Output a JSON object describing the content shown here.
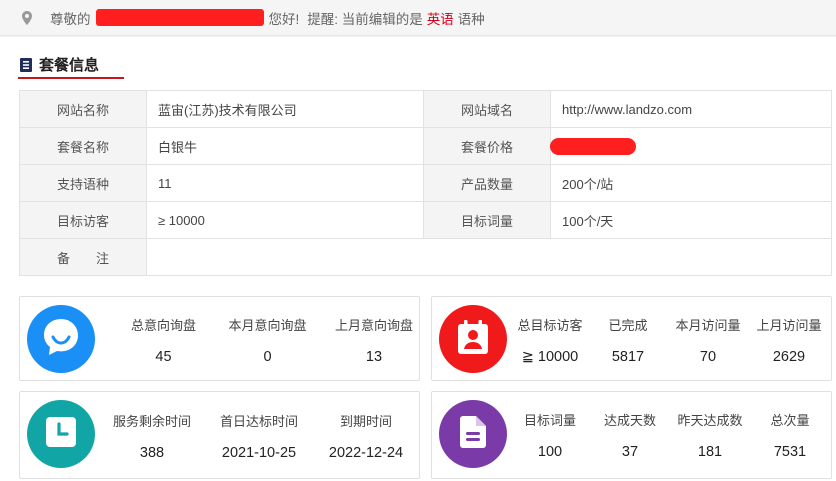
{
  "greeting": {
    "prefix": "尊敬的",
    "suffix": "您好!",
    "reminder_prefix": "提醒: 当前编辑的是",
    "language": "英语",
    "reminder_suffix": "语种"
  },
  "section": {
    "title": "套餐信息"
  },
  "info_rows": [
    {
      "l1": "网站名称",
      "v1": "蓝宙(江苏)技术有限公司",
      "l2": "网站域名",
      "v2": "http://www.landzo.com"
    },
    {
      "l1": "套餐名称",
      "v1": "白银牛",
      "l2": "套餐价格",
      "v2": ""
    },
    {
      "l1": "支持语种",
      "v1": "11",
      "l2": "产品数量",
      "v2": "200个/站"
    },
    {
      "l1": "目标访客",
      "v1": "≥ 10000",
      "l2": "目标词量",
      "v2": "100个/天"
    }
  ],
  "remark_label": "备　　注",
  "stats": {
    "inquiry": {
      "color": "#1a8ff5",
      "icon": "chat-bubble-icon",
      "items": [
        {
          "k": "总意向询盘",
          "v": "45"
        },
        {
          "k": "本月意向询盘",
          "v": "0"
        },
        {
          "k": "上月意向询盘",
          "v": "13"
        }
      ]
    },
    "visitors": {
      "color": "#f01a1a",
      "icon": "contact-card-icon",
      "items": [
        {
          "k": "总目标访客",
          "v": "≧ 10000"
        },
        {
          "k": "已完成",
          "v": "5817"
        },
        {
          "k": "本月访问量",
          "v": "70"
        },
        {
          "k": "上月访问量",
          "v": "2629"
        }
      ]
    },
    "time": {
      "color": "#12a5a6",
      "icon": "clock-icon",
      "items": [
        {
          "k": "服务剩余时间",
          "v": "388"
        },
        {
          "k": "首日达标时间",
          "v": "2021-10-25"
        },
        {
          "k": "到期时间",
          "v": "2022-12-24"
        }
      ]
    },
    "keywords": {
      "color": "#7a3aa8",
      "icon": "document-icon",
      "items": [
        {
          "k": "目标词量",
          "v": "100"
        },
        {
          "k": "达成天数",
          "v": "37"
        },
        {
          "k": "昨天达成数",
          "v": "181"
        },
        {
          "k": "总次量",
          "v": "7531"
        }
      ]
    }
  }
}
